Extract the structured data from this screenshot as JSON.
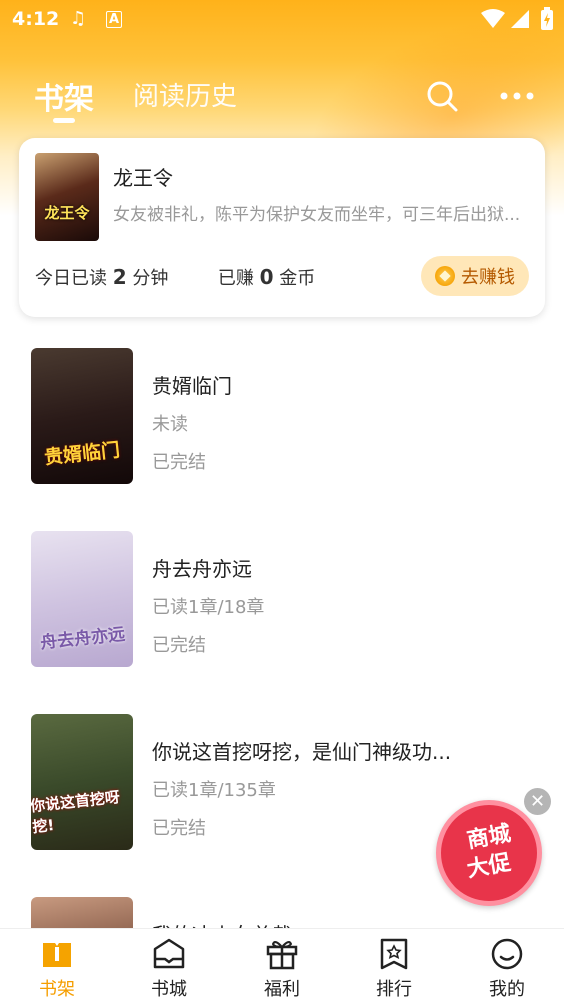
{
  "status_bar": {
    "time": "4:12",
    "music_icon": "music-note-icon",
    "a_icon": "a-badge-icon"
  },
  "tabs": {
    "shelf": "书架",
    "history": "阅读历史"
  },
  "reading_card": {
    "book_title": "龙王令",
    "description": "女友被非礼，陈平为保护女友而坐牢，可三年后出狱...",
    "stat_prefix": "今日已读",
    "minutes": "2",
    "minutes_unit": "分钟",
    "earned_prefix": "已赚",
    "coins": "0",
    "coins_unit": "金币",
    "earn_button": "去赚钱",
    "cover_text": "龙王令"
  },
  "books": [
    {
      "title": "贵婿临门",
      "progress": "未读",
      "status": "已完结",
      "cover_text": "贵婿临门"
    },
    {
      "title": "舟去舟亦远",
      "progress": "已读1章/18章",
      "status": "已完结",
      "cover_text": "舟去舟亦远"
    },
    {
      "title": "你说这首挖呀挖，是仙门神级功...",
      "progress": "已读1章/135章",
      "status": "已完结",
      "cover_text": "你说这首挖呀挖!"
    },
    {
      "title": "我的冰山女总裁",
      "progress": "",
      "status": "",
      "cover_text": ""
    }
  ],
  "promo": {
    "line1": "商城",
    "line2": "大促",
    "close": "✕"
  },
  "bottom_nav": [
    {
      "label": "书架",
      "icon": "bookshelf-icon"
    },
    {
      "label": "书城",
      "icon": "book-store-icon"
    },
    {
      "label": "福利",
      "icon": "gift-icon"
    },
    {
      "label": "排行",
      "icon": "ranking-icon"
    },
    {
      "label": "我的",
      "icon": "profile-icon"
    }
  ]
}
